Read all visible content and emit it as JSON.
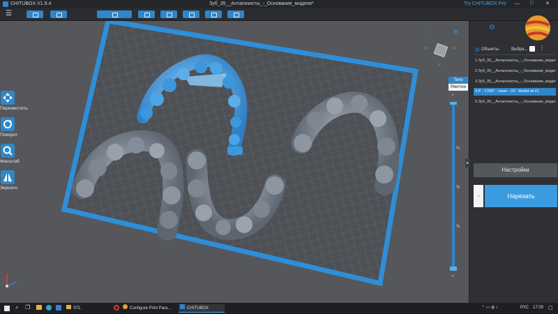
{
  "titlebar": {
    "app_name": "CHITUBOX V1.9.4",
    "document_title": "Зуб_35__Антагонисты_-_Основание_модели*",
    "pro_link": "Try CHITUBOX Pro"
  },
  "toolbar": {
    "buttons": [
      "open-file",
      "save",
      "undo-redo",
      "grid-view",
      "arrange",
      "support",
      "hollow",
      "slice-settings"
    ]
  },
  "left_tools": [
    {
      "label": "Переместить",
      "icon": "move-icon"
    },
    {
      "label": "Поворот",
      "icon": "rotate-icon"
    },
    {
      "label": "Масштаб",
      "icon": "scale-icon"
    },
    {
      "label": "Зеркало",
      "icon": "mirror-icon"
    }
  ],
  "view_modes": {
    "body": "Тело",
    "xray": "Рентген"
  },
  "slider_ticks": [
    "¼",
    "½",
    "¾"
  ],
  "objects_panel": {
    "header": "Объекты:",
    "select_label": "Выбра...",
    "items": [
      {
        "label": "1.Зуб_35__Антагонисты_-_Основание_модели",
        "selected": false
      },
      {
        "label": "2.Зуб_35__Антагонисты_-_Основание_модели",
        "selected": false
      },
      {
        "label": "3.Зуб_35__Антагонисты_-_Основание_модели",
        "selected": false
      },
      {
        "label": "4.P - 17587 - lower - 03 - Model.stl #1",
        "selected": true
      },
      {
        "label": "5.Зуб_35__Антагонисты_-_Основание_модели",
        "selected": false
      }
    ]
  },
  "settings_button": "Настройки",
  "slice_button": "Нарезать",
  "taskbar": {
    "items": [
      "STL",
      "Configure Print Para...",
      "CHITUBOX"
    ],
    "lang": "РУС",
    "time": "17:00"
  },
  "colors": {
    "accent": "#2f86c9",
    "viewport": "#55575b",
    "plate_border": "#2e8fd8",
    "selected_model": "#3d97dd"
  }
}
